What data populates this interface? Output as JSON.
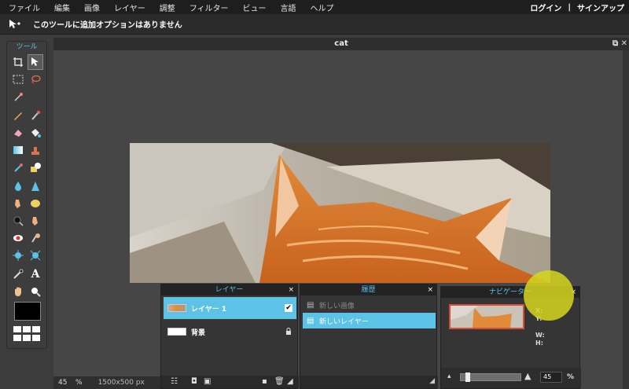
{
  "menu": [
    "ファイル",
    "編集",
    "画像",
    "レイヤー",
    "調整",
    "フィルター",
    "ビュー",
    "言語",
    "ヘルプ"
  ],
  "account": {
    "login": "ログイン",
    "separator": "|",
    "signup": "サインアップ"
  },
  "options_bar": {
    "message": "このツールに追加オプションはありません"
  },
  "document": {
    "title": "cat",
    "zoom": "45",
    "zoom_unit": "%",
    "dimensions": "1500x500 px"
  },
  "tools": {
    "title": "ツール",
    "text_tool_glyph": "A"
  },
  "layers_panel": {
    "title": "レイヤー",
    "close": "×",
    "layers": [
      {
        "name": "レイヤー 1",
        "visible_mark": "✔"
      },
      {
        "name": "背景",
        "lock_mark": "🔒"
      }
    ]
  },
  "history_panel": {
    "title": "履歴",
    "close": "×",
    "items": [
      "新しい画像",
      "新しいレイヤー"
    ]
  },
  "navigator_panel": {
    "title": "ナビゲーター",
    "close": "×",
    "x_label": "X:",
    "y_label": "Y:",
    "w_label": "W:",
    "h_label": "H:",
    "zoom": "45",
    "zoom_unit": "%"
  },
  "colors": {
    "accent": "#5cc2e6",
    "highlight_spot": "#d6d61e"
  }
}
